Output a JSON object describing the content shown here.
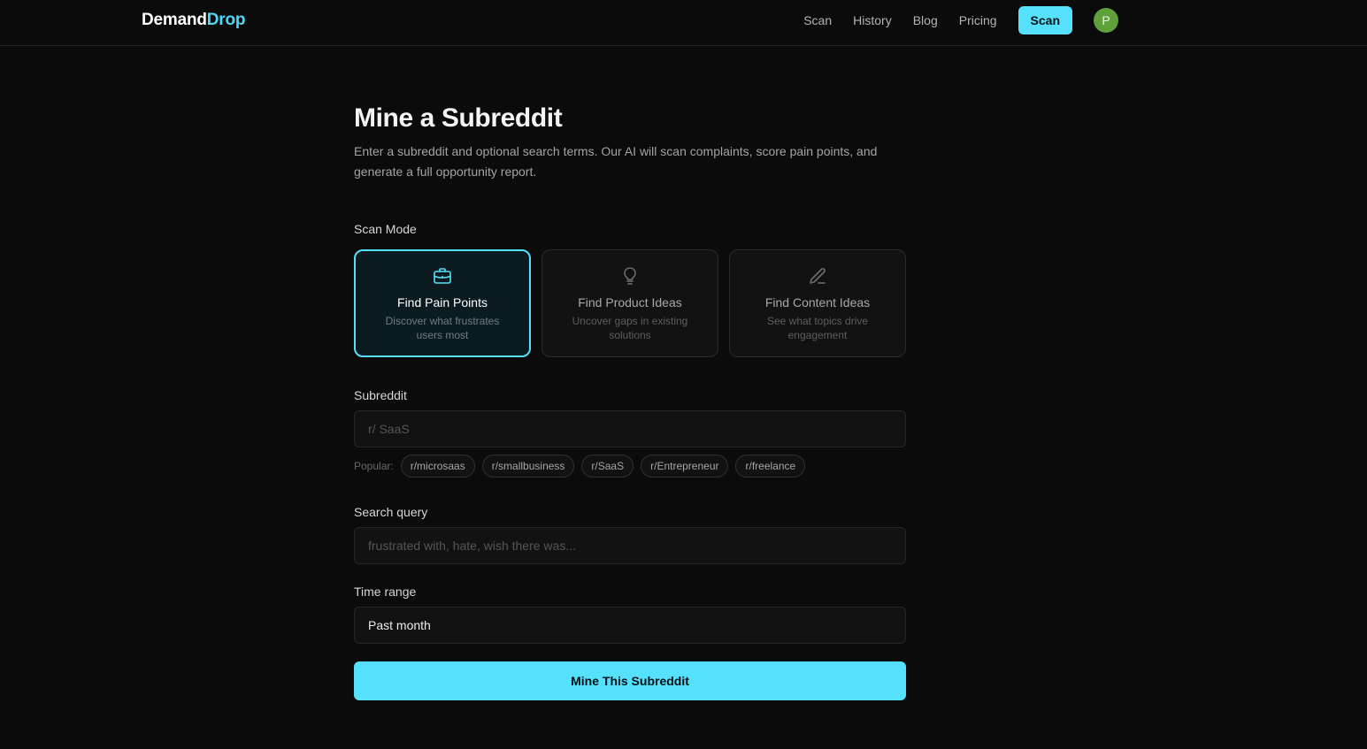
{
  "header": {
    "brand_primary": "Demand",
    "brand_accent": "Drop",
    "nav": [
      "Scan",
      "History",
      "Blog",
      "Pricing"
    ],
    "cta_label": "Scan",
    "avatar_initial": "P"
  },
  "main": {
    "title": "Mine a Subreddit",
    "description": "Enter a subreddit and optional search terms. Our AI will scan complaints, score pain points, and generate a full opportunity report.",
    "scan_mode_label": "Scan Mode",
    "modes": [
      {
        "title": "Find Pain Points",
        "subtitle": "Discover what frustrates users most",
        "icon": "briefcase-icon",
        "active": true
      },
      {
        "title": "Find Product Ideas",
        "subtitle": "Uncover gaps in existing solutions",
        "icon": "lightbulb-icon",
        "active": false
      },
      {
        "title": "Find Content Ideas",
        "subtitle": "See what topics drive engagement",
        "icon": "pencil-icon",
        "active": false
      }
    ],
    "subreddit_label": "Subreddit",
    "subreddit_placeholder": "r/ SaaS",
    "popular_label": "Popular:",
    "popular": [
      "r/microsaas",
      "r/smallbusiness",
      "r/SaaS",
      "r/Entrepreneur",
      "r/freelance"
    ],
    "search_label": "Search query",
    "search_placeholder": "frustrated with, hate, wish there was...",
    "time_label": "Time range",
    "time_value": "Past month",
    "submit_label": "Mine This Subreddit"
  },
  "colors": {
    "accent": "#55e1fb",
    "background": "#0b0b0b",
    "avatar": "#5fa03a"
  }
}
